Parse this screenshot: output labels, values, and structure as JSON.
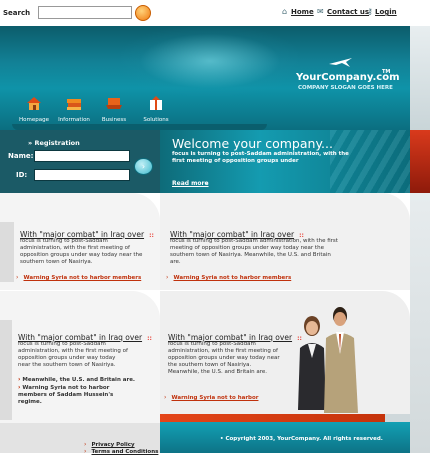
{
  "search": {
    "label": "Search",
    "value": "",
    "placeholder": ""
  },
  "toplinks": {
    "home": "Home",
    "contact": "Contact us",
    "login": "Login"
  },
  "brand": {
    "name": "YourCompany.com",
    "tm": "TM",
    "slogan": "COMPANY SLOGAN GOES HERE"
  },
  "nav": [
    {
      "label": "Homepage",
      "icon": "house-icon"
    },
    {
      "label": "Information",
      "icon": "books-icon"
    },
    {
      "label": "Business",
      "icon": "laptop-icon"
    },
    {
      "label": "Solutions",
      "icon": "gift-box-icon"
    }
  ],
  "registration": {
    "title": "Registration",
    "name_label": "Name:",
    "id_label": "ID:",
    "name_value": "",
    "id_value": ""
  },
  "welcome": {
    "title": "Welcome your company...",
    "text": "focus is turning to post-Saddam administration, with the first meeting of opposition groups under",
    "readmore": "Read more"
  },
  "cards": [
    {
      "title": "With \"major combat\" in Iraq over",
      "text": "focus is turning to post-Saddam administration, with the first meeting of opposition groups under way today near the southern town of Nasiriya.",
      "bold": "",
      "link": "Warning Syria not to harbor members of Saddam Hussein's regime."
    },
    {
      "title": "With \"major combat\" in Iraq over",
      "text": "focus is turning to post-Saddam administration, with the first meeting of opposition groups under way today near the southern town of Nasiriya. Meanwhile, the U.S. and Britain are.",
      "bold": "",
      "link": "Warning Syria not to harbor members of Saddam Hussein's regime."
    },
    {
      "title": "With \"major combat\" in Iraq over",
      "text": "focus is turning to post-Saddam administration, with the first meeting of opposition groups under way today near the southern town of Nasiriya.",
      "bold": "Meanwhile, the U.S. and Britain are.",
      "link": "Warning Syria not to harbor members of Saddam Hussein's regime."
    },
    {
      "title": "With \"major combat\" in Iraq over",
      "text": "focus is turning to post-Saddam administration, with the first meeting of opposition groups under way today near the southern town of Nasiriya. Meanwhile, the U.S. and Britain are.",
      "bold": "",
      "link": "Warning Syria not to harbor members of Saddam Hussein's regime."
    }
  ],
  "footer": {
    "privacy": "Privacy Policy",
    "terms": "Terms and Conditions",
    "copyright": "Copyright 2003, YourCompany. All rights reserved."
  },
  "colors": {
    "teal": "#128196",
    "red": "#c0310c",
    "dark_teal": "#1b5a66"
  }
}
